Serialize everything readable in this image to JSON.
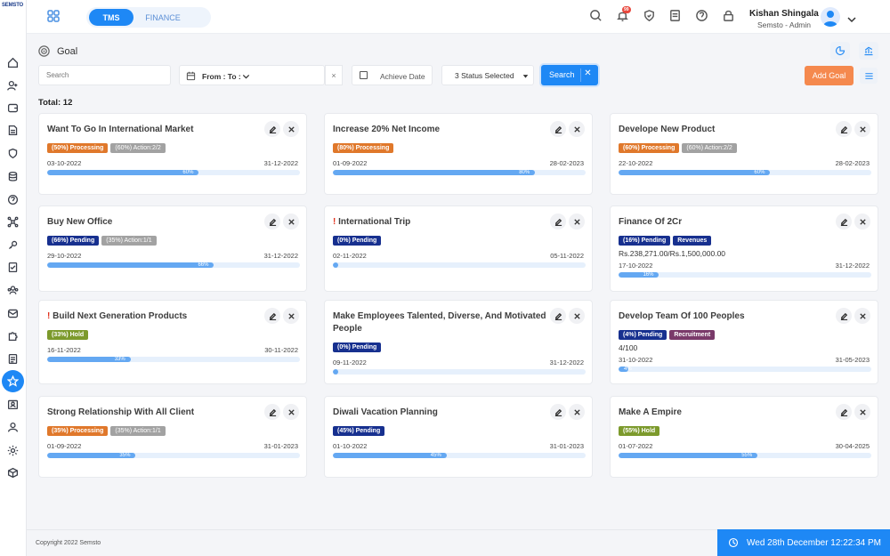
{
  "brand": {
    "logo": "SEMSTO"
  },
  "topbar": {
    "tabs": [
      "TMS",
      "FINANCE"
    ],
    "notification_count": "99",
    "user_name": "Kishan Shingala",
    "user_role": "Semsto - Admin"
  },
  "page": {
    "title": "Goal",
    "total_label": "Total: 12"
  },
  "filters": {
    "search_placeholder": "Search",
    "date_label": "From : To :",
    "clear_label": "×",
    "achieve_label": "Achieve Date",
    "status_selected": "3 Status Selected",
    "search_button": "Search",
    "add_goal": "Add Goal"
  },
  "colors": {
    "Processing": "#e0782b",
    "Pending": "#17308f",
    "Hold": "#7c9a2c",
    "Revenues": "#17308f",
    "Recruitment": "#7a3a6a",
    "Action": "#a2a2a2",
    "accent": "#1e88f5"
  },
  "goals": [
    {
      "title": "Want To Go In International Market",
      "urgent": false,
      "badges": [
        {
          "text": "(50%) Processing",
          "type": "Processing"
        },
        {
          "text": "(60%) Action:2/2",
          "type": "Action"
        }
      ],
      "extra": "",
      "start": "03-10-2022",
      "end": "31-12-2022",
      "progress": 60,
      "progress_label": "60%"
    },
    {
      "title": "Increase 20% Net Income",
      "urgent": false,
      "badges": [
        {
          "text": "(80%) Processing",
          "type": "Processing"
        }
      ],
      "extra": "",
      "start": "01-09-2022",
      "end": "28-02-2023",
      "progress": 80,
      "progress_label": "80%"
    },
    {
      "title": "Develope New Product",
      "urgent": false,
      "badges": [
        {
          "text": "(60%) Processing",
          "type": "Processing"
        },
        {
          "text": "(60%) Action:2/2",
          "type": "Action"
        }
      ],
      "extra": "",
      "start": "22-10-2022",
      "end": "28-02-2023",
      "progress": 60,
      "progress_label": "60%"
    },
    {
      "title": "Buy New Office",
      "urgent": false,
      "badges": [
        {
          "text": "(66%) Pending",
          "type": "Pending"
        },
        {
          "text": "(35%) Action:1/1",
          "type": "Action"
        }
      ],
      "extra": "",
      "start": "29-10-2022",
      "end": "31-12-2022",
      "progress": 66,
      "progress_label": "66%"
    },
    {
      "title": "International Trip",
      "urgent": true,
      "badges": [
        {
          "text": "(0%) Pending",
          "type": "Pending"
        }
      ],
      "extra": "",
      "start": "02-11-2022",
      "end": "05-11-2022",
      "progress": 2,
      "progress_label": ""
    },
    {
      "title": "Finance Of 2Cr",
      "urgent": false,
      "badges": [
        {
          "text": "(16%) Pending",
          "type": "Pending"
        },
        {
          "text": "Revenues",
          "type": "Revenues"
        }
      ],
      "extra": "Rs.238,271.00/Rs.1,500,000.00",
      "start": "17-10-2022",
      "end": "31-12-2022",
      "progress": 16,
      "progress_label": "16%"
    },
    {
      "title": "Build Next Generation Products",
      "urgent": true,
      "badges": [
        {
          "text": "(33%) Hold",
          "type": "Hold"
        }
      ],
      "extra": "",
      "start": "16-11-2022",
      "end": "30-11-2022",
      "progress": 33,
      "progress_label": "33%"
    },
    {
      "title": "Make Employees Talented, Diverse, And Motivated People",
      "urgent": false,
      "badges": [
        {
          "text": "(0%) Pending",
          "type": "Pending"
        }
      ],
      "extra": "",
      "start": "09-11-2022",
      "end": "31-12-2022",
      "progress": 2,
      "progress_label": ""
    },
    {
      "title": "Develop Team Of 100 Peoples",
      "urgent": false,
      "badges": [
        {
          "text": "(4%) Pending",
          "type": "Pending"
        },
        {
          "text": "Recruitment",
          "type": "Recruitment"
        }
      ],
      "extra": "4/100",
      "start": "31-10-2022",
      "end": "31-05-2023",
      "progress": 4,
      "progress_label": "4%"
    },
    {
      "title": "Strong Relationship With All Client",
      "urgent": false,
      "badges": [
        {
          "text": "(35%) Processing",
          "type": "Processing"
        },
        {
          "text": "(35%) Action:1/1",
          "type": "Action"
        }
      ],
      "extra": "",
      "start": "01-09-2022",
      "end": "31-01-2023",
      "progress": 35,
      "progress_label": "35%"
    },
    {
      "title": "Diwali Vacation Planning",
      "urgent": false,
      "badges": [
        {
          "text": "(45%) Pending",
          "type": "Pending"
        }
      ],
      "extra": "",
      "start": "01-10-2022",
      "end": "31-01-2023",
      "progress": 45,
      "progress_label": "45%"
    },
    {
      "title": "Make A Empire",
      "urgent": false,
      "badges": [
        {
          "text": "(55%) Hold",
          "type": "Hold"
        }
      ],
      "extra": "",
      "start": "01-07-2022",
      "end": "30-04-2025",
      "progress": 55,
      "progress_label": "55%"
    }
  ],
  "footer": {
    "copyright": "Copyright 2022 Semsto",
    "datetime": "Wed 28th December 12:22:34 PM"
  }
}
